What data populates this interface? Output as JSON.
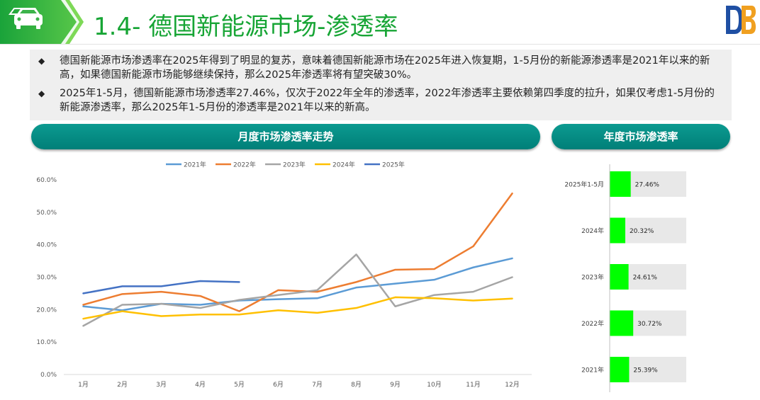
{
  "header": {
    "title": "1.4- 德国新能源市场-渗透率",
    "logo_text": "DB"
  },
  "bullets": [
    {
      "marker": "◆",
      "text": "德国新能源市场渗透率在2025年得到了明显的复苏，意味着德国新能源市场在2025年进入恢复期，1-5月份的新能源渗透率是2021年以来的新高，如果德国新能源市场能够继续保持，那么2025年渗透率将有望突破30%。"
    },
    {
      "marker": "◆",
      "text": "2025年1-5月，德国新能源市场渗透率27.46%，仅次于2022年全年的渗透率，2022年渗透率主要依赖第四季度的拉升，如果仅考虑1-5月份的新能源渗透率，那么2025年1-5月份的渗透率是2021年以来的新高。"
    }
  ],
  "sections": {
    "monthly_title": "月度市场渗透率走势",
    "annual_title": "年度市场渗透率"
  },
  "colors": {
    "title_green": "#17a535",
    "teal": "#008a82",
    "bar_green": "#00ff00",
    "bar_bg": "#e8e8e8"
  },
  "chart_data": [
    {
      "type": "line",
      "categories": [
        "1月",
        "2月",
        "3月",
        "4月",
        "5月",
        "6月",
        "7月",
        "8月",
        "9月",
        "10月",
        "11月",
        "12月"
      ],
      "y_ticks": [
        "0.0%",
        "10.0%",
        "20.0%",
        "30.0%",
        "40.0%",
        "50.0%",
        "60.0%"
      ],
      "ylim": [
        0,
        60
      ],
      "legend_position": "top",
      "grid": false,
      "series": [
        {
          "name": "2021年",
          "color": "#5b9bd5",
          "values": [
            21.0,
            19.8,
            21.8,
            21.5,
            22.8,
            23.2,
            23.5,
            26.8,
            28.0,
            29.2,
            33.0,
            35.8
          ]
        },
        {
          "name": "2022年",
          "color": "#ed7d31",
          "values": [
            21.5,
            24.8,
            25.5,
            24.2,
            19.5,
            26.0,
            25.5,
            28.5,
            32.3,
            32.5,
            39.5,
            55.8
          ]
        },
        {
          "name": "2023年",
          "color": "#a5a5a5",
          "values": [
            15.0,
            21.5,
            21.8,
            20.5,
            23.0,
            24.5,
            26.0,
            37.0,
            21.0,
            24.5,
            25.5,
            30.0
          ]
        },
        {
          "name": "2024年",
          "color": "#ffc000",
          "values": [
            17.2,
            19.5,
            18.0,
            18.5,
            18.5,
            19.8,
            19.0,
            20.5,
            23.8,
            23.5,
            22.8,
            23.4
          ]
        },
        {
          "name": "2025年",
          "color": "#4472c4",
          "values": [
            25.0,
            27.2,
            27.2,
            28.8,
            28.5
          ]
        }
      ]
    },
    {
      "type": "bar",
      "orientation": "horizontal",
      "categories": [
        "2025年1-5月",
        "2024年",
        "2023年",
        "2022年",
        "2021年"
      ],
      "values": [
        27.46,
        20.32,
        24.61,
        30.72,
        25.39
      ],
      "labels": [
        "27.46%",
        "20.32%",
        "24.61%",
        "30.72%",
        "25.39%"
      ],
      "xlim": [
        0,
        100
      ]
    }
  ]
}
